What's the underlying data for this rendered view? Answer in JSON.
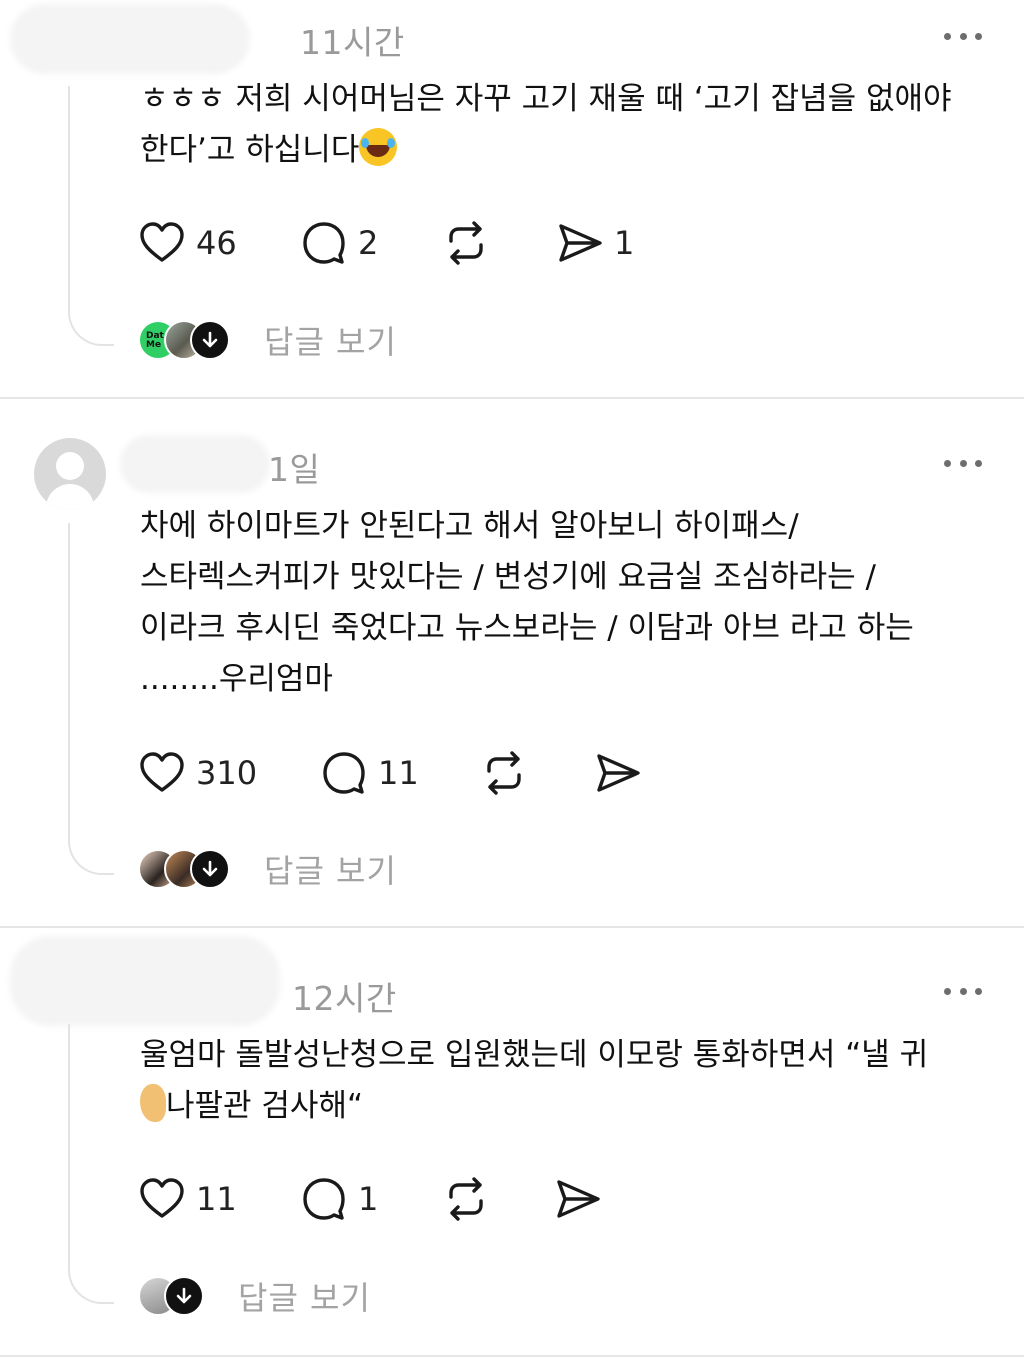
{
  "posts": [
    {
      "time": "11시간",
      "text": "ㅎㅎㅎ 저희 시어머님은 자꾸 고기 재울 때 ‘고기 잡념을 없애야\n한다’고 하십니다",
      "emoji": "face-with-tears-of-joy",
      "likes": "46",
      "comments": "2",
      "shares": "1",
      "replies_label": "답글 보기"
    },
    {
      "time": "1일",
      "text": "차에 하이마트가 안된다고 해서 알아보니 하이패스/\n스타렉스커피가 맛있다는 / 변성기에 요금실 조심하라는 /\n이라크 후시딘 죽었다고 뉴스보라는 / 이담과 아브 라고 하는\n........우리엄마",
      "likes": "310",
      "comments": "11",
      "shares": "",
      "replies_label": "답글 보기"
    },
    {
      "time": "12시간",
      "text_line1": "울엄마 돌발성난청으로 입원했는데 이모랑 통화하면서 “낼 귀",
      "text_line2": "나팔관 검사해“",
      "emoji": "ear",
      "likes": "11",
      "comments": "1",
      "shares": "",
      "replies_label": "답글 보기"
    }
  ],
  "avatar_badge_text": "Dat Me",
  "icons": [
    "heart-icon",
    "comment-icon",
    "repost-icon",
    "share-icon",
    "more-icon",
    "arrow-down-icon"
  ]
}
